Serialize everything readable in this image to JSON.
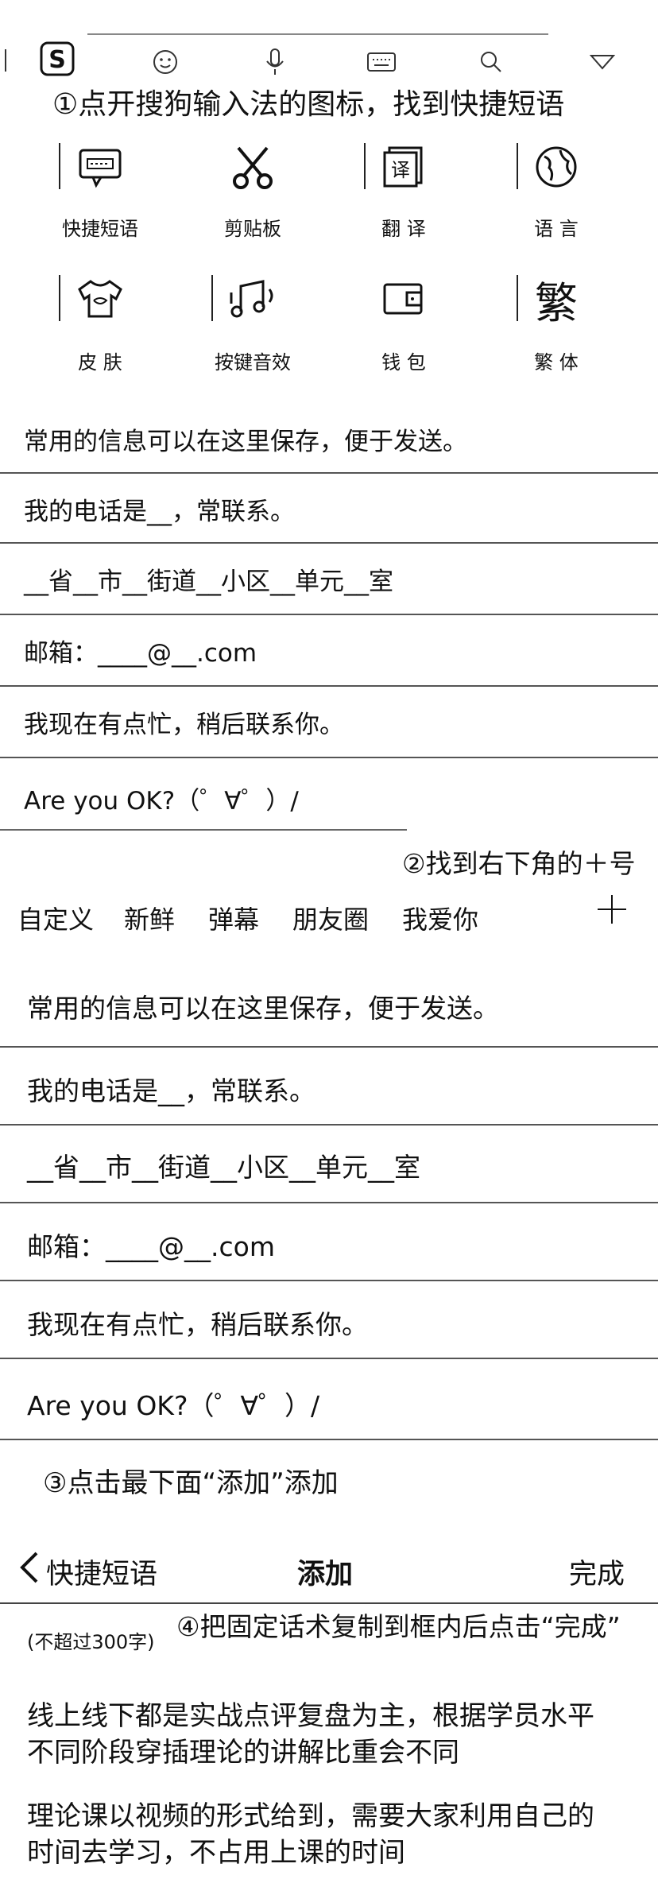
{
  "toolbar": {
    "icons": [
      "sogou-logo-icon",
      "emoji-icon",
      "microphone-icon",
      "keyboard-icon",
      "search-icon",
      "collapse-icon"
    ]
  },
  "steps": {
    "step1": "①点开搜狗输入法的图标，找到快捷短语",
    "step2": "②找到右下角的＋号",
    "step3": "③点击最下面“添加”添加",
    "step4": "④把固定话术复制到框内后点击“完成”"
  },
  "tiles": [
    {
      "label": "快捷短语",
      "icon": "quick-phrase-icon"
    },
    {
      "label": "剪贴板",
      "icon": "scissors-icon"
    },
    {
      "label": "翻 译",
      "icon": "translate-icon"
    },
    {
      "label": "语 言",
      "icon": "globe-icon"
    },
    {
      "label": "皮 肤",
      "icon": "tshirt-icon"
    },
    {
      "label": "按键音效",
      "icon": "music-icon"
    },
    {
      "label": "钱 包",
      "icon": "wallet-icon"
    },
    {
      "label": "繁 体",
      "icon": "traditional-char-icon",
      "glyph": "繁"
    }
  ],
  "phrases": [
    "常用的信息可以在这里保存，便于发送。",
    "我的电话是__，常联系。",
    "__省__市__街道__小区__单元__室",
    "邮箱：____@__.com",
    "我现在有点忙，稍后联系你。",
    "Are you OK?（゜∀゜）/"
  ],
  "tabs": [
    "自定义",
    "新鲜",
    "弹幕",
    "朋友圈",
    "我爱你"
  ],
  "add_symbol": "+",
  "nav": {
    "back_label": "快捷短语",
    "title": "添加",
    "done": "完成"
  },
  "editor": {
    "limit": "(不超过300字)",
    "para1": "线上线下都是实战点评复盘为主，根据学员水平\n不同阶段穿插理论的讲解比重会不同",
    "para2": "理论课以视频的形式给到，需要大家利用自己的\n时间去学习，不占用上课的时间"
  }
}
